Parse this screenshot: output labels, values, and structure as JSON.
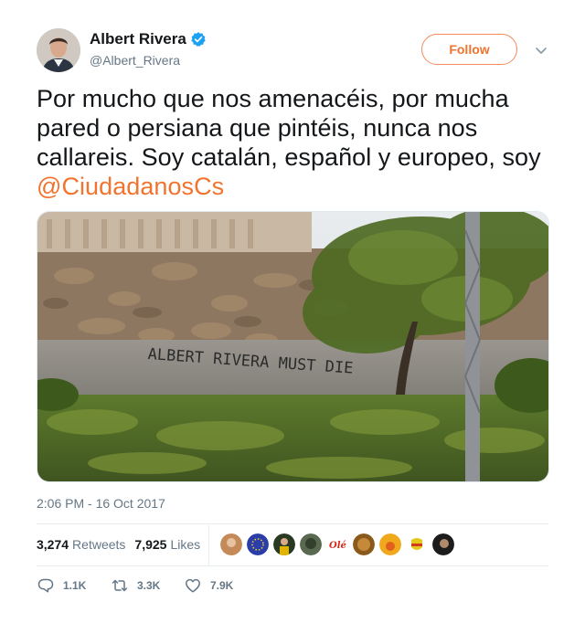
{
  "user": {
    "display_name": "Albert Rivera",
    "handle": "@Albert_Rivera",
    "verified": true
  },
  "follow_label": "Follow",
  "tweet": {
    "text": "Por mucho que nos amenacéis, por mucha pared o persiana que pintéis, nunca nos callareis. Soy catalán, español y europeo, soy ",
    "mention": "@CiudadanosCs"
  },
  "media": {
    "graffiti_text": "ALBERT RIVERA MUST DIE"
  },
  "timestamp": "2:06 PM - 16 Oct 2017",
  "stats": {
    "retweets_count": "3,274",
    "retweets_label": "Retweets",
    "likes_count": "7,925",
    "likes_label": "Likes"
  },
  "actions": {
    "reply_count": "1.1K",
    "retweet_count": "3.3K",
    "like_count": "7.9K"
  },
  "colors": {
    "accent": "#f1732e",
    "verified": "#1da1f2",
    "secondary_text": "#657786"
  },
  "icons": [
    "verified-badge-icon",
    "chevron-down-icon",
    "reply-icon",
    "retweet-icon",
    "heart-icon"
  ]
}
